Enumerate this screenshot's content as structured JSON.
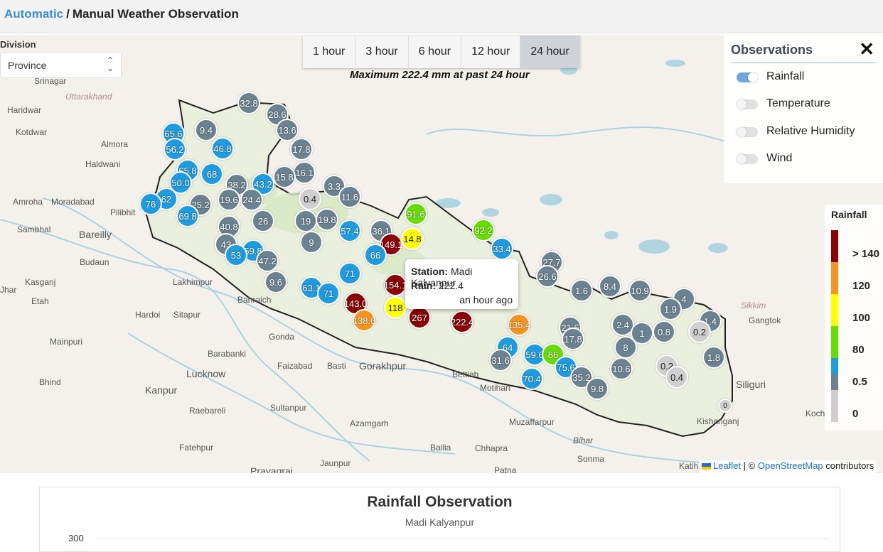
{
  "breadcrumb": {
    "link": "Automatic",
    "separator": "/",
    "current": "Manual Weather Observation"
  },
  "division": {
    "label": "Division",
    "selected": "Province"
  },
  "time_tabs": [
    {
      "label": "1 hour",
      "active": false
    },
    {
      "label": "3 hour",
      "active": false
    },
    {
      "label": "6 hour",
      "active": false
    },
    {
      "label": "12 hour",
      "active": false
    },
    {
      "label": "24 hour",
      "active": true
    }
  ],
  "max_text": "Maximum 222.4 mm at past 24 hour",
  "observations": {
    "title": "Observations",
    "close": "✕",
    "items": [
      {
        "label": "Rainfall",
        "on": true
      },
      {
        "label": "Temperature",
        "on": false
      },
      {
        "label": "Relative Humidity",
        "on": false
      },
      {
        "label": "Wind",
        "on": false
      }
    ]
  },
  "legend": {
    "title": "Rainfall",
    "ticks": [
      "> 140",
      "120",
      "100",
      "80",
      "0.5",
      "0"
    ],
    "colors": [
      "#8b0000",
      "#f7931e",
      "#ffff00",
      "#66dd00",
      "#1f9be0",
      "#6b8290",
      "#cfcfcf"
    ]
  },
  "popup": {
    "station_label": "Station:",
    "station": "Madi Kalyanpur",
    "rain_label": "Rain:",
    "rain": "222.4",
    "time": "an hour ago"
  },
  "attribution": {
    "leaflet": "Leaflet",
    "sep": "| ©",
    "osm": "OpenStreetMap",
    "rest": "contributors"
  },
  "place_names": [
    "Srinagar",
    "Uttarakhand",
    "Haridwar",
    "Kotdwar",
    "Almora",
    "Haldwani",
    "Amroha",
    "Moradabad",
    "Pilibhit",
    "Sambhal",
    "Bareilly",
    "Budaun",
    "Kasganj",
    "Lakhimpur",
    "Etah",
    "Hardoi",
    "Sitapur",
    "Bahraich",
    "Gonda",
    "Mainpuri",
    "Barabanki",
    "Faizabad",
    "Basti",
    "Gorakhpur",
    "Lucknow",
    "Kanpur",
    "Raebareli",
    "Sultanpur",
    "Azamgarh",
    "Fatehpur",
    "Prayagraj",
    "Jaunpur",
    "Ballia",
    "Chhapra",
    "Patna",
    "Bettiah",
    "Motihari",
    "Muzaffarpur",
    "Bihar",
    "Sonma",
    "Katihar",
    "Kishanganj",
    "Siliguri",
    "Gangtok",
    "Sikkim",
    "Koch",
    "Bhind",
    "Jhar",
    "Kanpur"
  ],
  "markers": [
    {
      "v": "32.8",
      "c": "grey"
    },
    {
      "v": "28.6",
      "c": "grey"
    },
    {
      "v": "13.6",
      "c": "grey"
    },
    {
      "v": "65.6",
      "c": "blue"
    },
    {
      "v": "9.4",
      "c": "grey"
    },
    {
      "v": "56.2",
      "c": "blue"
    },
    {
      "v": "46.8",
      "c": "blue"
    },
    {
      "v": "17.8",
      "c": "grey"
    },
    {
      "v": "65.8",
      "c": "blue"
    },
    {
      "v": "68",
      "c": "blue"
    },
    {
      "v": "16.1",
      "c": "grey"
    },
    {
      "v": "50.0",
      "c": "blue"
    },
    {
      "v": "38.2",
      "c": "grey"
    },
    {
      "v": "43.2",
      "c": "blue"
    },
    {
      "v": "15.8",
      "c": "grey"
    },
    {
      "v": "62",
      "c": "blue"
    },
    {
      "v": "19.6",
      "c": "grey"
    },
    {
      "v": "3.3",
      "c": "grey"
    },
    {
      "v": "11.6",
      "c": "grey"
    },
    {
      "v": "76",
      "c": "blue"
    },
    {
      "v": "25.2",
      "c": "grey"
    },
    {
      "v": "24.4",
      "c": "grey"
    },
    {
      "v": "0.4",
      "c": "light"
    },
    {
      "v": "69.8",
      "c": "blue"
    },
    {
      "v": "26",
      "c": "grey"
    },
    {
      "v": "19",
      "c": "grey"
    },
    {
      "v": "19.8",
      "c": "grey"
    },
    {
      "v": "91.6",
      "c": "green"
    },
    {
      "v": "40.8",
      "c": "grey"
    },
    {
      "v": "57.4",
      "c": "blue"
    },
    {
      "v": "36.1",
      "c": "grey"
    },
    {
      "v": "92.2",
      "c": "green"
    },
    {
      "v": "9",
      "c": "grey"
    },
    {
      "v": "149.1",
      "c": "dred"
    },
    {
      "v": "14.8",
      "c": "yellow"
    },
    {
      "v": "43",
      "c": "grey"
    },
    {
      "v": "59.8",
      "c": "blue"
    },
    {
      "v": "53",
      "c": "blue"
    },
    {
      "v": "66",
      "c": "blue"
    },
    {
      "v": "33.4",
      "c": "blue"
    },
    {
      "v": "47.2",
      "c": "grey"
    },
    {
      "v": "27.7",
      "c": "grey"
    },
    {
      "v": "71",
      "c": "blue"
    },
    {
      "v": "26.6",
      "c": "grey"
    },
    {
      "v": "9.6",
      "c": "grey"
    },
    {
      "v": "63.1",
      "c": "blue"
    },
    {
      "v": "154.1",
      "c": "dred"
    },
    {
      "v": "71",
      "c": "blue"
    },
    {
      "v": "1.6",
      "c": "grey"
    },
    {
      "v": "8.4",
      "c": "grey"
    },
    {
      "v": "10.9",
      "c": "grey"
    },
    {
      "v": "143.0",
      "c": "dred"
    },
    {
      "v": "118",
      "c": "yellow"
    },
    {
      "v": "4",
      "c": "grey"
    },
    {
      "v": "138.6",
      "c": "orange"
    },
    {
      "v": "267",
      "c": "dred"
    },
    {
      "v": "222.4",
      "c": "dred"
    },
    {
      "v": "135.4",
      "c": "orange"
    },
    {
      "v": "21.6",
      "c": "grey"
    },
    {
      "v": "1.9",
      "c": "grey"
    },
    {
      "v": "1.4",
      "c": "grey"
    },
    {
      "v": "2.4",
      "c": "grey"
    },
    {
      "v": "1",
      "c": "grey"
    },
    {
      "v": "0.8",
      "c": "grey"
    },
    {
      "v": "0.2",
      "c": "light"
    },
    {
      "v": "64",
      "c": "blue"
    },
    {
      "v": "17.8",
      "c": "grey"
    },
    {
      "v": "31.6",
      "c": "grey"
    },
    {
      "v": "59.6",
      "c": "blue"
    },
    {
      "v": "86",
      "c": "green"
    },
    {
      "v": "75.6",
      "c": "blue"
    },
    {
      "v": "10.6",
      "c": "grey"
    },
    {
      "v": "1.8",
      "c": "grey"
    },
    {
      "v": "0.2",
      "c": "light"
    },
    {
      "v": "70.4",
      "c": "blue"
    },
    {
      "v": "35.2",
      "c": "grey"
    },
    {
      "v": "9.8",
      "c": "grey"
    },
    {
      "v": "0.4",
      "c": "light"
    },
    {
      "v": "0",
      "c": "light"
    },
    {
      "v": "8",
      "c": "grey"
    }
  ],
  "chart": {
    "title": "Rainfall Observation",
    "subtitle": "Madi Kalyanpur",
    "y_top": "300"
  }
}
